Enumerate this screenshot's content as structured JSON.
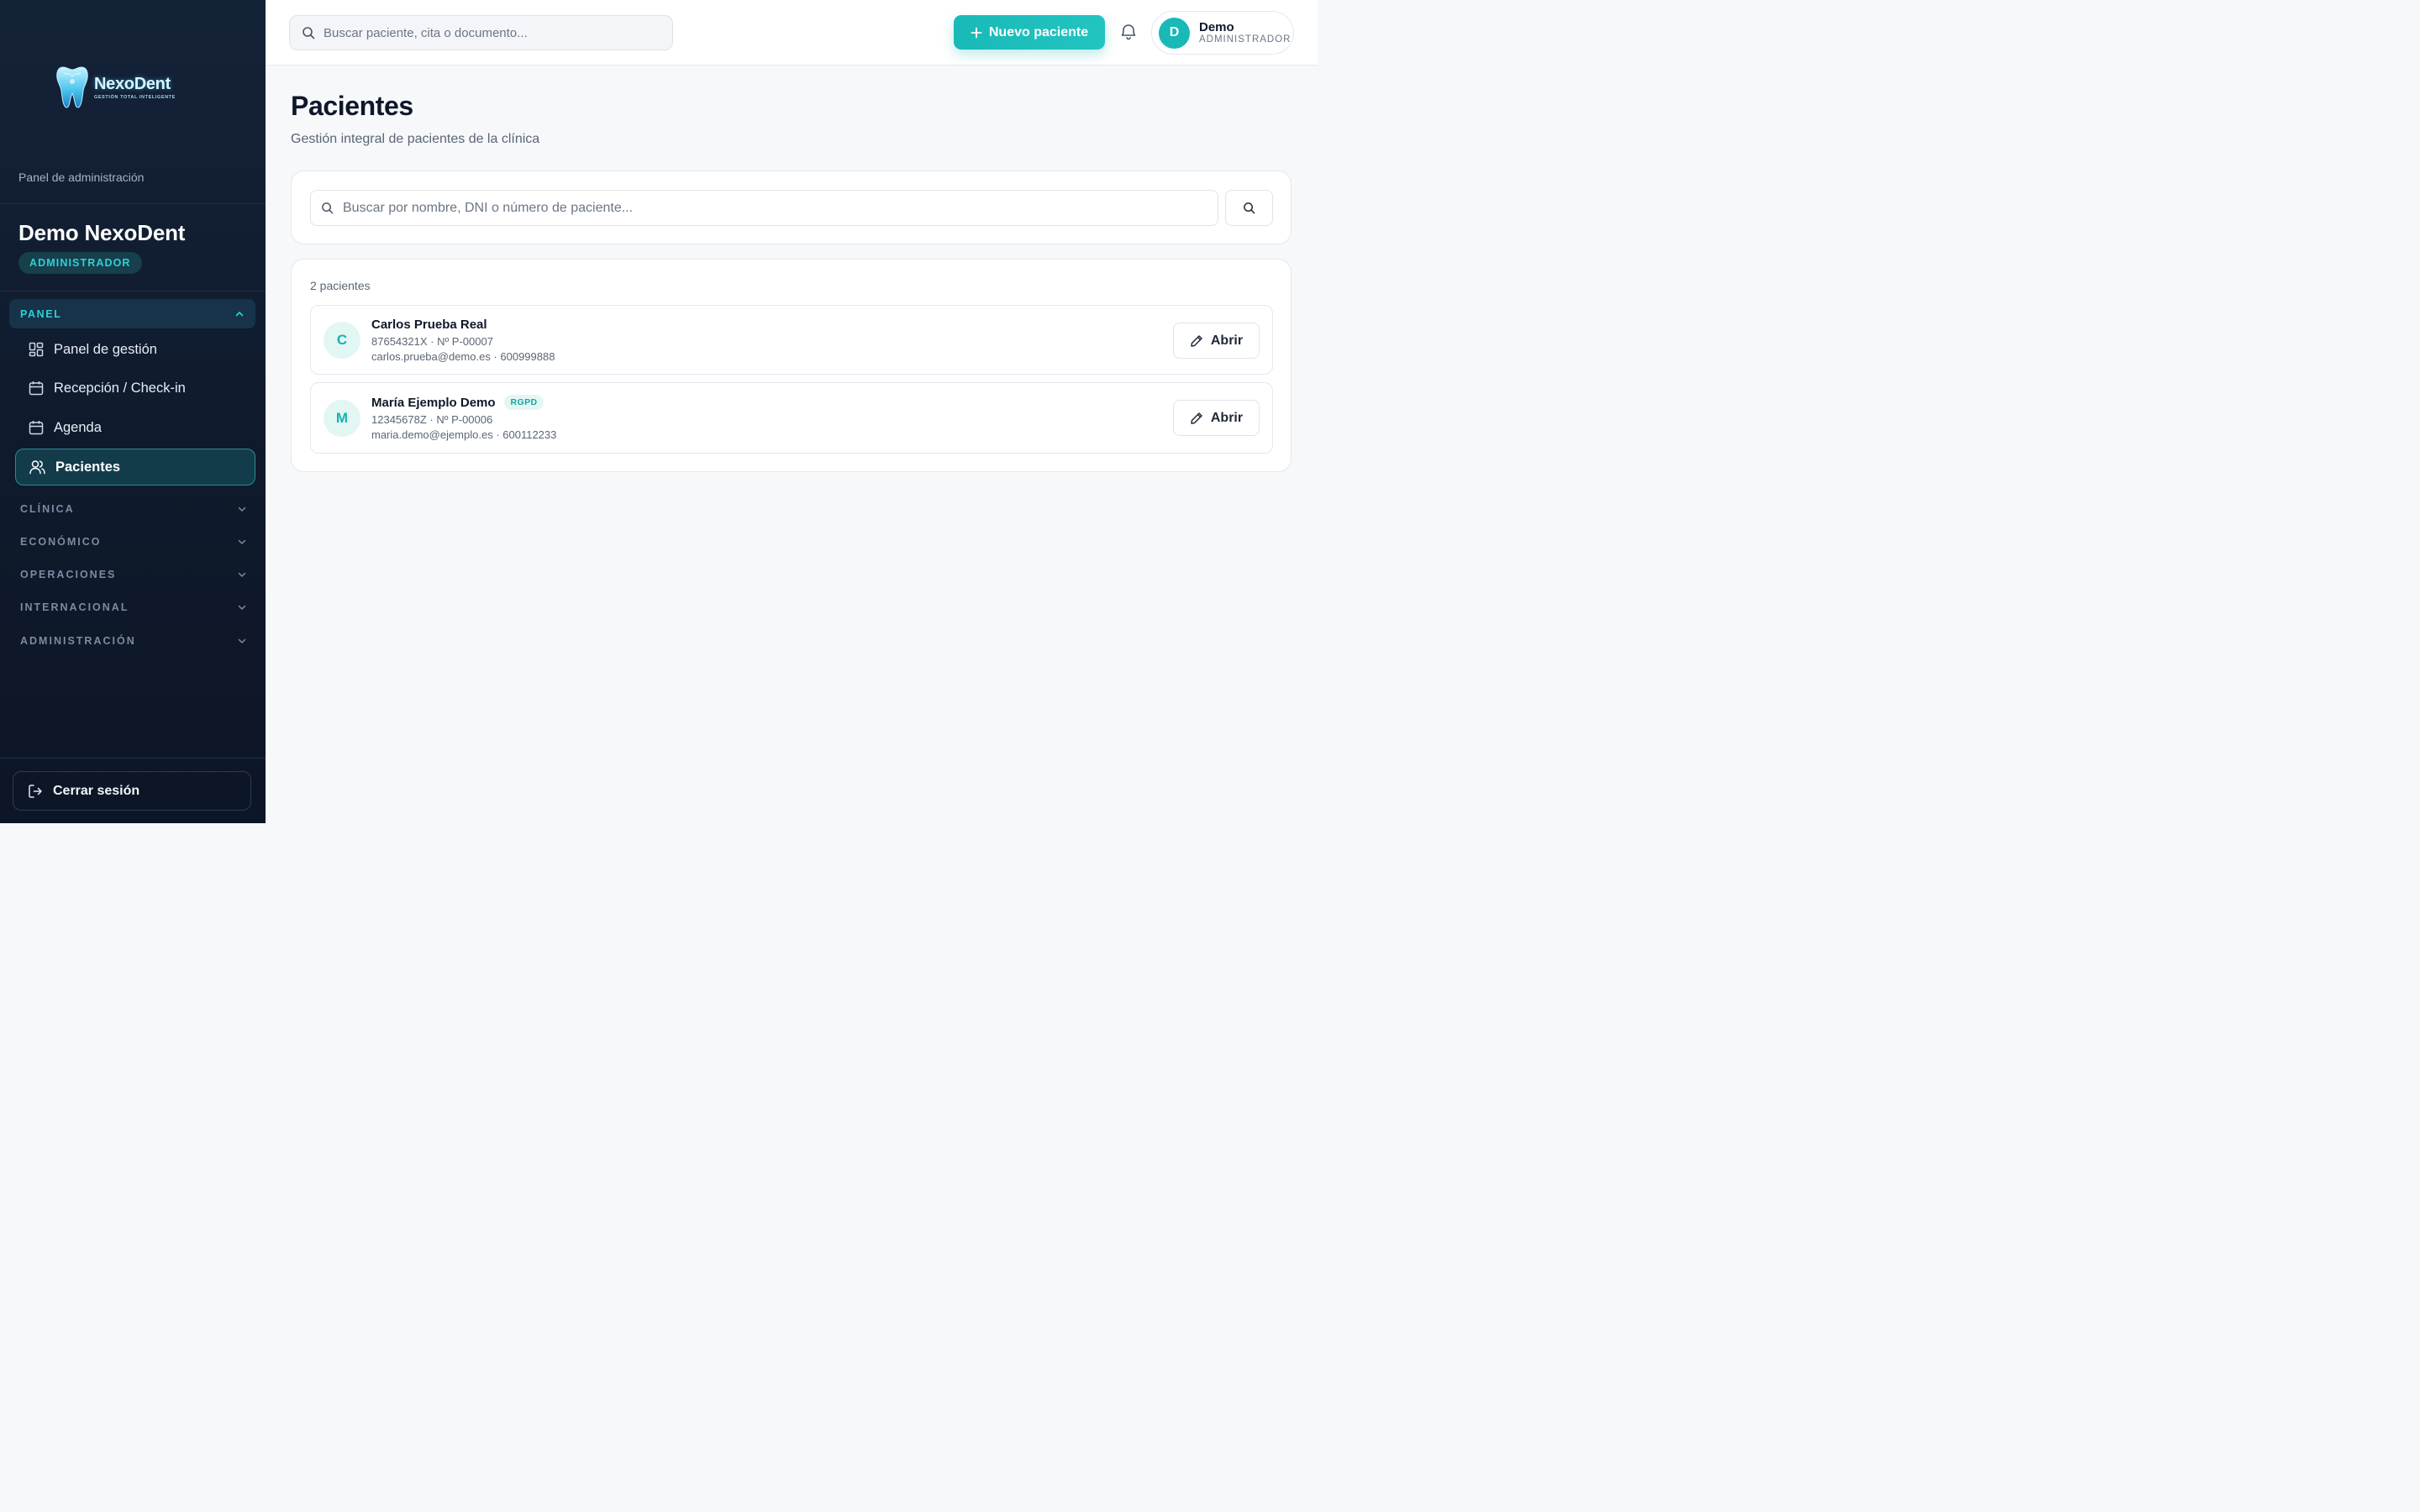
{
  "sidebar": {
    "logo": {
      "word": "NexoDent",
      "tagline": "GESTIÓN TOTAL INTELIGENTE"
    },
    "panel_label": "Panel de administración",
    "org_name": "Demo NexoDent",
    "role_badge": "ADMINISTRADOR",
    "open_section": {
      "label": "PANEL",
      "icon": "chevron-up-icon"
    },
    "items": [
      {
        "label": "Panel de gestión",
        "icon": "grid-icon",
        "active": false
      },
      {
        "label": "Recepción / Check-in",
        "icon": "calendar-icon",
        "active": false
      },
      {
        "label": "Agenda",
        "icon": "calendar-icon",
        "active": false
      },
      {
        "label": "Pacientes",
        "icon": "users-icon",
        "active": true
      }
    ],
    "sections": [
      {
        "label": "CLÍNICA",
        "icon": "chevron-down-icon"
      },
      {
        "label": "ECONÓMICO",
        "icon": "chevron-down-icon"
      },
      {
        "label": "OPERACIONES",
        "icon": "chevron-down-icon"
      },
      {
        "label": "INTERNACIONAL",
        "icon": "chevron-down-icon"
      },
      {
        "label": "ADMINISTRACIÓN",
        "icon": "chevron-down-icon"
      }
    ],
    "logout_label": "Cerrar sesión"
  },
  "topbar": {
    "search_placeholder": "Buscar paciente, cita o documento...",
    "new_patient_label": "Nuevo paciente",
    "user": {
      "initial": "D",
      "name": "Demo",
      "role": "ADMINISTRADOR"
    }
  },
  "main": {
    "title": "Pacientes",
    "subtitle": "Gestión integral de pacientes de la clínica",
    "search_placeholder": "Buscar por nombre, DNI o número de paciente...",
    "count_text": "2 pacientes",
    "patients": [
      {
        "initial": "C",
        "name": "Carlos Prueba Real",
        "badge": "",
        "id_line": "87654321X · Nº P-00007",
        "contact_line": "carlos.prueba@demo.es · 600999888",
        "action_label": "Abrir"
      },
      {
        "initial": "M",
        "name": "María Ejemplo Demo",
        "badge": "RGPD",
        "id_line": "12345678Z · Nº P-00006",
        "contact_line": "maria.demo@ejemplo.es · 600112233",
        "action_label": "Abrir"
      }
    ]
  },
  "colors": {
    "accent": "#19b9b7",
    "sidebar_bg": "#142238",
    "active_item_bg": "#133c4b",
    "badge_text": "#2fd0d4"
  }
}
